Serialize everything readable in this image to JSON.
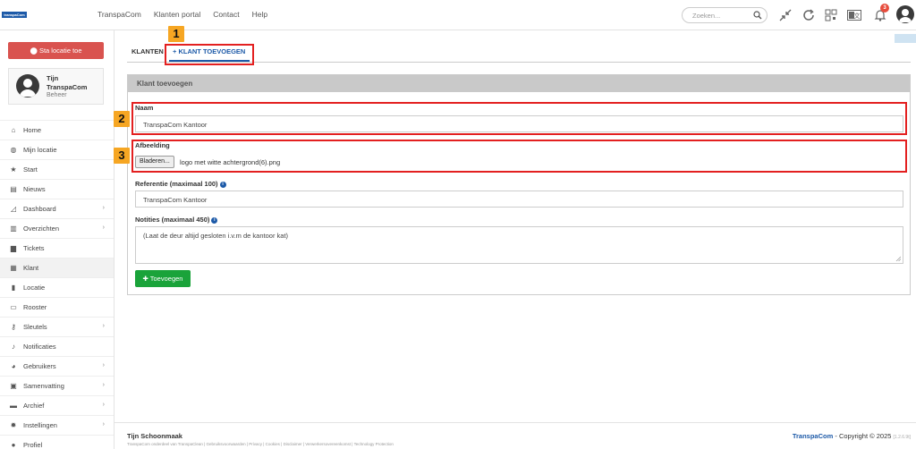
{
  "topbar": {
    "logo_text": "transpaCom",
    "nav": [
      "TranspaCom",
      "Klanten portal",
      "Contact",
      "Help"
    ],
    "search_placeholder": "Zoeken...",
    "notification_count": "3"
  },
  "sidebar": {
    "location_button": "Sta locatie toe",
    "user": {
      "first_name": "Tijn",
      "company": "TranspaCom",
      "role": "Beheer"
    },
    "items": [
      {
        "label": "Home",
        "icon": "home-icon",
        "glyph": "⌂",
        "chevron": false
      },
      {
        "label": "Mijn locatie",
        "icon": "globe-icon",
        "glyph": "◍",
        "chevron": false
      },
      {
        "label": "Start",
        "icon": "star-icon",
        "glyph": "★",
        "chevron": false
      },
      {
        "label": "Nieuws",
        "icon": "newspaper-icon",
        "glyph": "▤",
        "chevron": false
      },
      {
        "label": "Dashboard",
        "icon": "chart-icon",
        "glyph": "◿",
        "chevron": true
      },
      {
        "label": "Overzichten",
        "icon": "document-icon",
        "glyph": "▥",
        "chevron": true
      },
      {
        "label": "Tickets",
        "icon": "comment-icon",
        "glyph": "▆",
        "chevron": false
      },
      {
        "label": "Klant",
        "icon": "building-icon",
        "glyph": "▦",
        "chevron": false
      },
      {
        "label": "Locatie",
        "icon": "building-icon",
        "glyph": "▮",
        "chevron": false
      },
      {
        "label": "Rooster",
        "icon": "calendar-icon",
        "glyph": "▭",
        "chevron": false
      },
      {
        "label": "Sleutels",
        "icon": "key-icon",
        "glyph": "⚷",
        "chevron": true
      },
      {
        "label": "Notificaties",
        "icon": "bell-icon",
        "glyph": "♪",
        "chevron": false
      },
      {
        "label": "Gebruikers",
        "icon": "users-icon",
        "glyph": "◕",
        "chevron": true
      },
      {
        "label": "Samenvatting",
        "icon": "clipboard-icon",
        "glyph": "▣",
        "chevron": true
      },
      {
        "label": "Archief",
        "icon": "archive-icon",
        "glyph": "▬",
        "chevron": true
      },
      {
        "label": "Instellingen",
        "icon": "gear-icon",
        "glyph": "✹",
        "chevron": true
      },
      {
        "label": "Profiel",
        "icon": "user-icon",
        "glyph": "●",
        "chevron": false
      }
    ]
  },
  "tabs": {
    "klanten": "KLANTEN",
    "add": "+ KLANT TOEVOEGEN"
  },
  "form": {
    "title": "Klant toevoegen",
    "name_label": "Naam",
    "name_value": "TranspaCom Kantoor",
    "image_label": "Afbeelding",
    "browse_button": "Bladeren...",
    "file_name": "logo met witte achtergrond(6).png",
    "reference_label": "Referentie (maximaal 100)",
    "reference_value": "TranspaCom Kantoor",
    "notes_label": "Notities (maximaal 450)",
    "notes_value": "(Laat de deur altijd gesloten i.v.m de kantoor kat)",
    "submit_button": "Toevoegen"
  },
  "annotations": [
    "1",
    "2",
    "3"
  ],
  "footer": {
    "left": "Tijn Schoonmaak",
    "small": "TranspaCom onderdeel van TranspaClean | Gebruiksvoorwaarden | Privacy | Cookies | Disclaimer | Verwerkersovereenkomst | Technology Protection",
    "brand": "TranspaCom",
    "copyright": " - Copyright © 2025",
    "version": "[1.2.6.9t]"
  },
  "colors": {
    "accent": "#1d5aa8",
    "danger": "#d9534f",
    "success": "#1aa33a",
    "highlight": "#e32020",
    "marker": "#f6a623"
  }
}
